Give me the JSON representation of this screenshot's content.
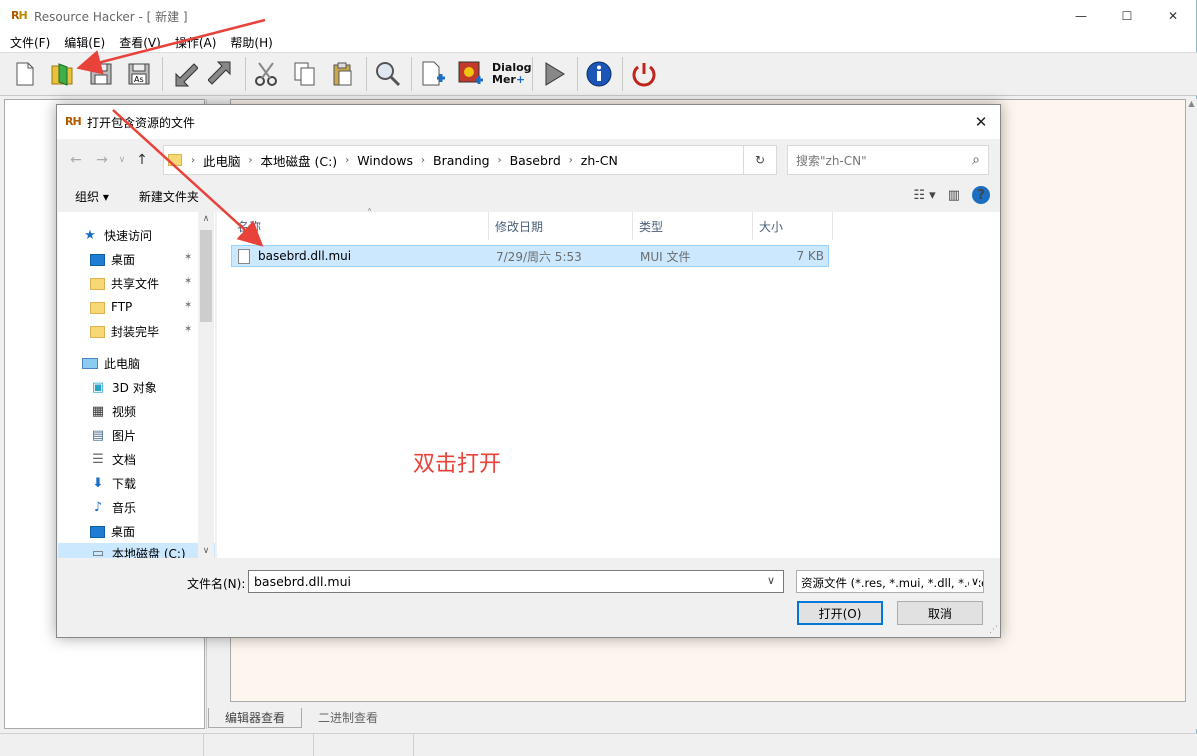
{
  "main": {
    "title": "Resource Hacker - [ 新建 ]",
    "logo_text": "RH",
    "menu": [
      "文件(F)",
      "编辑(E)",
      "查看(V)",
      "操作(A)",
      "帮助(H)"
    ],
    "toolbar_dialog_label_1": "Dialog",
    "toolbar_dialog_label_2": "Mer",
    "bottom_tabs": [
      "编辑器查看",
      "二进制查看"
    ]
  },
  "dialog": {
    "title": "打开包含资源的文件",
    "breadcrumb": [
      "此电脑",
      "本地磁盘 (C:)",
      "Windows",
      "Branding",
      "Basebrd",
      "zh-CN"
    ],
    "search_placeholder": "搜索\"zh-CN\"",
    "commands": {
      "organize": "组织 ▾",
      "new_folder": "新建文件夹"
    },
    "nav": {
      "quick_access": "快速访问",
      "pinned": [
        "桌面",
        "共享文件",
        "FTP",
        "封装完毕"
      ],
      "this_pc": "此电脑",
      "pc_items": [
        "3D 对象",
        "视频",
        "图片",
        "文档",
        "下载",
        "音乐",
        "桌面",
        "本地磁盘 (C:)"
      ]
    },
    "columns": {
      "name": "名称",
      "date": "修改日期",
      "type": "类型",
      "size": "大小"
    },
    "files": [
      {
        "name": "basebrd.dll.mui",
        "date": "7/29/周六 5:53",
        "type": "MUI 文件",
        "size": "7 KB"
      }
    ],
    "annotation": "双击打开",
    "filename_label": "文件名(N):",
    "filename_value": "basebrd.dll.mui",
    "filetype": "资源文件 (*.res, *.mui, *.dll, *.exe)",
    "ok": "打开(O)",
    "cancel": "取消"
  },
  "colors": {
    "accent": "#0078d7",
    "annotation": "#e8423a",
    "selection": "#cce8ff"
  }
}
